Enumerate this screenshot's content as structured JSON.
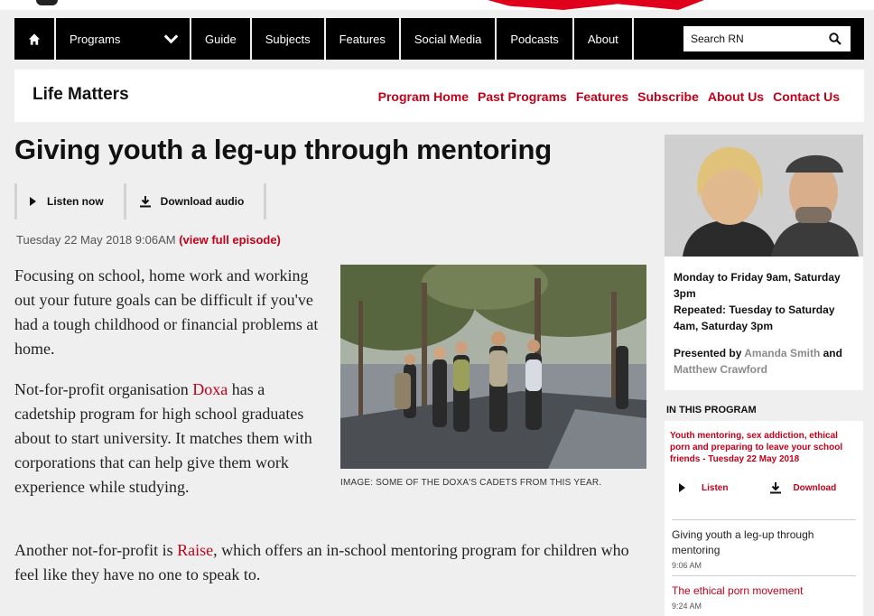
{
  "nav": {
    "items": [
      "Programs",
      "Guide",
      "Subjects",
      "Features",
      "Social Media",
      "Podcasts",
      "About"
    ],
    "search_placeholder": "Search RN"
  },
  "program": {
    "title": "Life Matters",
    "links": [
      "Program Home",
      "Past Programs",
      "Features",
      "Subscribe",
      "About Us",
      "Contact Us"
    ]
  },
  "article": {
    "headline": "Giving youth a leg-up through mentoring",
    "listen_label": "Listen now",
    "download_label": "Download audio",
    "date": "Tuesday 22 May 2018 9:06AM",
    "full_episode_link": "(view full episode)",
    "p1": "Focusing on school, home work and working out your future goals can be difficult if you've had a tough childhood or financial problems at home.",
    "p2_before": "Not-for-profit organisation ",
    "p2_link": "Doxa",
    "p2_after": " has a cadetship program for high school graduates about to start university. It matches them with corporations that can help give them work experience while studying.",
    "p3_before": "Another not-for-profit is ",
    "p3_link": "Raise",
    "p3_after": ", which offers an in-school mentoring program for children who feel like they have no one to speak to.",
    "image_caption": "IMAGE: SOME OF THE DOXA'S CADETS FROM THIS YEAR."
  },
  "sidebar": {
    "schedule": "Monday to Friday 9am, Saturday 3pm",
    "repeated": "Repeated: Tuesday to Saturday 4am, Saturday 3pm",
    "presented_by": "Presented by ",
    "host1": "Amanda Smith",
    "and": " and ",
    "host2": "Matthew Crawford",
    "in_program_heading": "IN THIS PROGRAM",
    "episode_title": "Youth mentoring, sex addiction, ethical porn and preparing to leave your school friends - Tuesday 22 May 2018",
    "listen": "Listen",
    "download": "Download",
    "segments": [
      {
        "title": "Giving youth a leg-up through mentoring",
        "time": "9:06 AM"
      },
      {
        "title": "The ethical porn movement",
        "time": "9:24 AM"
      }
    ]
  }
}
